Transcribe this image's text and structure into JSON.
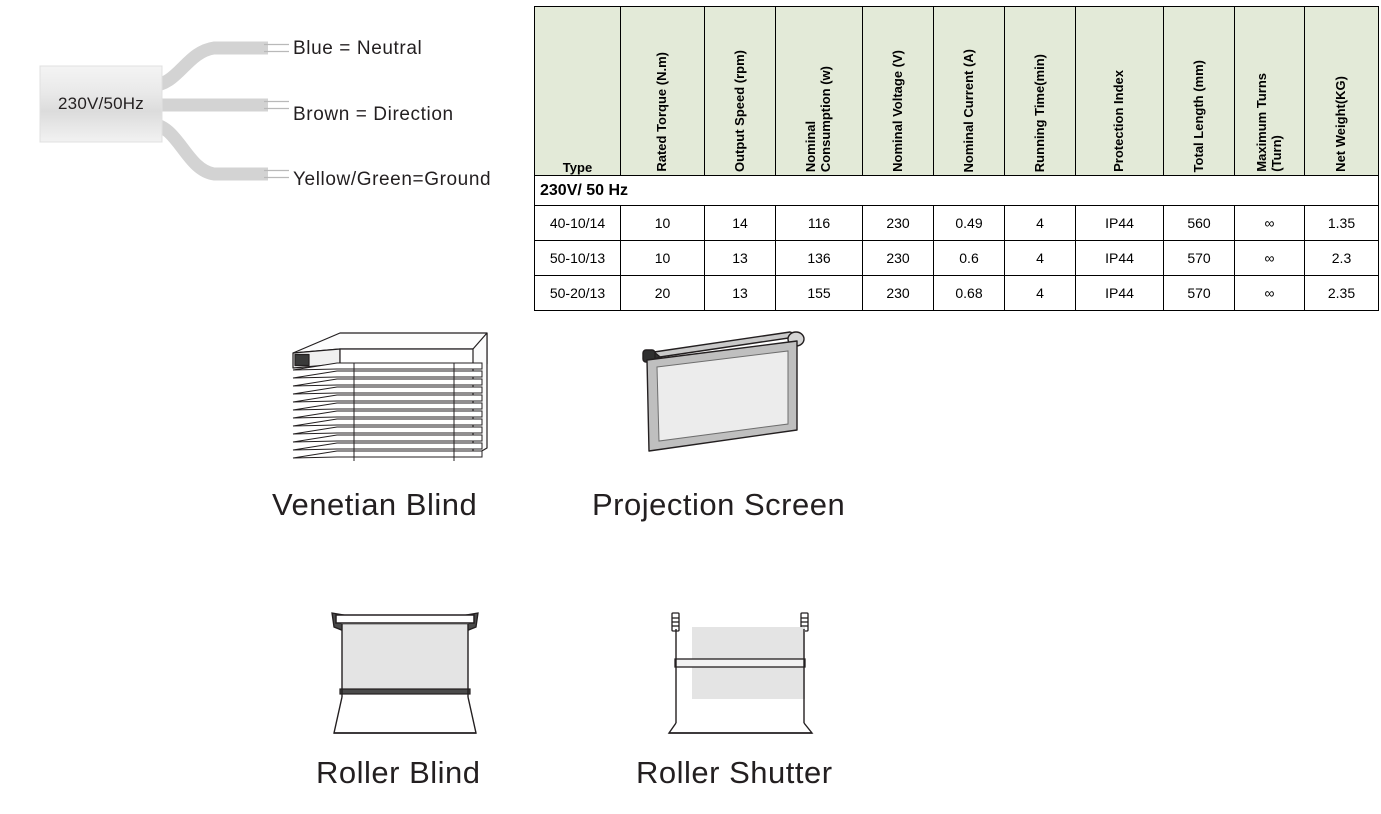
{
  "wiring": {
    "motor_label": "230V/50Hz",
    "wires": [
      {
        "id": "blue",
        "label": "Blue = Neutral"
      },
      {
        "id": "brown",
        "label": "Brown = Direction"
      },
      {
        "id": "ground",
        "label": "Yellow/Green=Ground"
      }
    ]
  },
  "table": {
    "headers": [
      "Type",
      "Rated Torque (N.m)",
      "Output Speed (rpm)",
      "Nominal\nConsumption (w)",
      "Nominal Voltage (V)",
      "Nominal Current (A)",
      "Running Time(min)",
      "Protection Index",
      "Total Length (mm)",
      "Maximum Turns\n(Turn)",
      "Net Weight(KG)"
    ],
    "section_label": "230V/ 50 Hz",
    "rows": [
      {
        "type": "40-10/14",
        "rated_torque": "10",
        "output_speed": "14",
        "nominal_consumption": "116",
        "nominal_voltage": "230",
        "nominal_current": "0.49",
        "running_time": "4",
        "protection_index": "IP44",
        "total_length": "560",
        "maximum_turns": "∞",
        "net_weight": "1.35"
      },
      {
        "type": "50-10/13",
        "rated_torque": "10",
        "output_speed": "13",
        "nominal_consumption": "136",
        "nominal_voltage": "230",
        "nominal_current": "0.6",
        "running_time": "4",
        "protection_index": "IP44",
        "total_length": "570",
        "maximum_turns": "∞",
        "net_weight": "2.3"
      },
      {
        "type": "50-20/13",
        "rated_torque": "20",
        "output_speed": "13",
        "nominal_consumption": "155",
        "nominal_voltage": "230",
        "nominal_current": "0.68",
        "running_time": "4",
        "protection_index": "IP44",
        "total_length": "570",
        "maximum_turns": "∞",
        "net_weight": "2.35"
      }
    ],
    "header_bg": "#e3ead8",
    "border_color": "#000000"
  },
  "illustrations": [
    {
      "id": "venetian-blind",
      "caption": "Venetian Blind"
    },
    {
      "id": "projection-screen",
      "caption": "Projection Screen"
    },
    {
      "id": "roller-blind",
      "caption": "Roller Blind"
    },
    {
      "id": "roller-shutter",
      "caption": "Roller Shutter"
    }
  ]
}
